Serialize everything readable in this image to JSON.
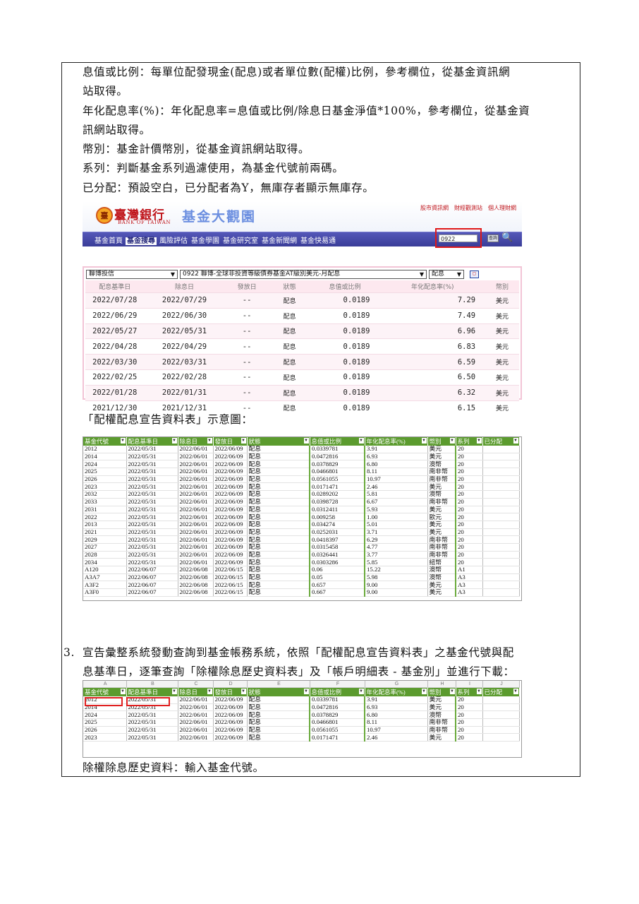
{
  "intro_lines": [
    "息值或比例：每單位配發現金(配息)或者單位數(配權)比例，參考欄位，從基金資訊網",
    "站取得。",
    "年化配息率(%)：年化配息率=息值或比例/除息日基金淨值*100%，參考欄位，從基金資",
    "訊網站取得。",
    "幣別：基金計價幣別，從基金資訊網站取得。",
    "系列：判斷基金系列過濾使用，為基金代號前兩碼。",
    "已分配：預設空白，已分配者為Y，無庫存者顯示無庫存。"
  ],
  "site": {
    "bank_name": "臺灣銀行",
    "bank_en": "BANK OF TAIWAN",
    "site_title": "基金大觀園",
    "top_links": "股市資訊網　財經觀測站　個人理財網",
    "nav": [
      "基金首頁",
      "基金搜尋",
      "風險評估",
      "基金學園",
      "基金研究室",
      "基金新聞網",
      "基金快易通"
    ],
    "nav_active": 1,
    "search_value": "0922",
    "query_label": "查詢",
    "company_select": "聯博投信",
    "fund_select": "0922 聯博-全球非投資等級債券基金AT級別美元-月配息",
    "type_select": "配息",
    "columns": [
      "配息基準日",
      "除息日",
      "發放日",
      "狀態",
      "息值或比例",
      "年化配息率(%)",
      "幣別"
    ],
    "rows": [
      [
        "2022/07/28",
        "2022/07/29",
        "--",
        "配息",
        "0.0189",
        "7.29",
        "美元"
      ],
      [
        "2022/06/29",
        "2022/06/30",
        "--",
        "配息",
        "0.0189",
        "7.49",
        "美元"
      ],
      [
        "2022/05/27",
        "2022/05/31",
        "--",
        "配息",
        "0.0189",
        "6.96",
        "美元"
      ],
      [
        "2022/04/28",
        "2022/04/29",
        "--",
        "配息",
        "0.0189",
        "6.83",
        "美元"
      ],
      [
        "2022/03/30",
        "2022/03/31",
        "--",
        "配息",
        "0.0189",
        "6.59",
        "美元"
      ],
      [
        "2022/02/25",
        "2022/02/28",
        "--",
        "配息",
        "0.0189",
        "6.50",
        "美元"
      ],
      [
        "2022/01/28",
        "2022/01/31",
        "--",
        "配息",
        "0.0189",
        "6.32",
        "美元"
      ],
      [
        "2021/12/30",
        "2021/12/31",
        "--",
        "配息",
        "0.0189",
        "6.15",
        "美元"
      ]
    ]
  },
  "caption1": "「配權配息宣告資料表」示意圖：",
  "xls_headers": [
    "基金代號",
    "配息基準日",
    "除息日",
    "發放日",
    "狀態",
    "息值或比例",
    "年化配息率(%)",
    "幣別",
    "系列",
    "已分配"
  ],
  "xls_rows": [
    [
      "2012",
      "2022/05/31",
      "2022/06/01",
      "2022/06/09",
      "配息",
      "0.0339781",
      "3.91",
      "美元",
      "20",
      ""
    ],
    [
      "2014",
      "2022/05/31",
      "2022/06/01",
      "2022/06/09",
      "配息",
      "0.0472816",
      "6.93",
      "美元",
      "20",
      ""
    ],
    [
      "2024",
      "2022/05/31",
      "2022/06/01",
      "2022/06/09",
      "配息",
      "0.0378829",
      "6.80",
      "澳幣",
      "20",
      ""
    ],
    [
      "2025",
      "2022/05/31",
      "2022/06/01",
      "2022/06/09",
      "配息",
      "0.0466801",
      "8.11",
      "南非幣",
      "20",
      ""
    ],
    [
      "2026",
      "2022/05/31",
      "2022/06/01",
      "2022/06/09",
      "配息",
      "0.0561055",
      "10.97",
      "南非幣",
      "20",
      ""
    ],
    [
      "2023",
      "2022/05/31",
      "2022/06/01",
      "2022/06/09",
      "配息",
      "0.0171471",
      "2.46",
      "美元",
      "20",
      ""
    ],
    [
      "2032",
      "2022/05/31",
      "2022/06/01",
      "2022/06/09",
      "配息",
      "0.0289202",
      "5.81",
      "澳幣",
      "20",
      ""
    ],
    [
      "2033",
      "2022/05/31",
      "2022/06/01",
      "2022/06/09",
      "配息",
      "0.0398728",
      "6.67",
      "南非幣",
      "20",
      ""
    ],
    [
      "2031",
      "2022/05/31",
      "2022/06/01",
      "2022/06/09",
      "配息",
      "0.0312411",
      "5.93",
      "美元",
      "20",
      ""
    ],
    [
      "2022",
      "2022/05/31",
      "2022/06/01",
      "2022/06/09",
      "配息",
      "0.009258",
      "1.00",
      "歐元",
      "20",
      ""
    ],
    [
      "2013",
      "2022/05/31",
      "2022/06/01",
      "2022/06/09",
      "配息",
      "0.034274",
      "5.01",
      "美元",
      "20",
      ""
    ],
    [
      "2021",
      "2022/05/31",
      "2022/06/01",
      "2022/06/09",
      "配息",
      "0.0252031",
      "3.71",
      "美元",
      "20",
      ""
    ],
    [
      "2029",
      "2022/05/31",
      "2022/06/01",
      "2022/06/09",
      "配息",
      "0.0418397",
      "6.29",
      "南非幣",
      "20",
      ""
    ],
    [
      "2027",
      "2022/05/31",
      "2022/06/01",
      "2022/06/09",
      "配息",
      "0.0315458",
      "4.77",
      "南非幣",
      "20",
      ""
    ],
    [
      "2028",
      "2022/05/31",
      "2022/06/01",
      "2022/06/09",
      "配息",
      "0.0326441",
      "3.77",
      "南非幣",
      "20",
      ""
    ],
    [
      "2034",
      "2022/05/31",
      "2022/06/01",
      "2022/06/09",
      "配息",
      "0.0303286",
      "5.85",
      "紐幣",
      "20",
      ""
    ],
    [
      "A120",
      "2022/06/07",
      "2022/06/08",
      "2022/06/15",
      "配息",
      "0.06",
      "15.22",
      "澳幣",
      "A1",
      ""
    ],
    [
      "A3A7",
      "2022/06/07",
      "2022/06/08",
      "2022/06/15",
      "配息",
      "0.05",
      "5.98",
      "澳幣",
      "A3",
      ""
    ],
    [
      "A3F2",
      "2022/06/07",
      "2022/06/08",
      "2022/06/15",
      "配息",
      "0.657",
      "9.00",
      "美元",
      "A3",
      ""
    ],
    [
      "A3F0",
      "2022/06/07",
      "2022/06/08",
      "2022/06/15",
      "配息",
      "0.667",
      "9.00",
      "美元",
      "A3",
      ""
    ]
  ],
  "step3_num": "3.",
  "step3_lines": [
    "宣告彙整系統發動查詢到基金帳務系統，依照「配權配息宣告資料表」之基金代號與配",
    "息基準日，逐筆查詢「除權除息歷史資料表」及「帳戶明細表 - 基金別」並進行下載："
  ],
  "xls2_col_letters": [
    "A",
    "B",
    "C",
    "D",
    "E",
    "F",
    "G",
    "H",
    "I",
    "J"
  ],
  "xls2_rows_count": 6,
  "final_line": "除權除息歷史資料：輸入基金代號。"
}
